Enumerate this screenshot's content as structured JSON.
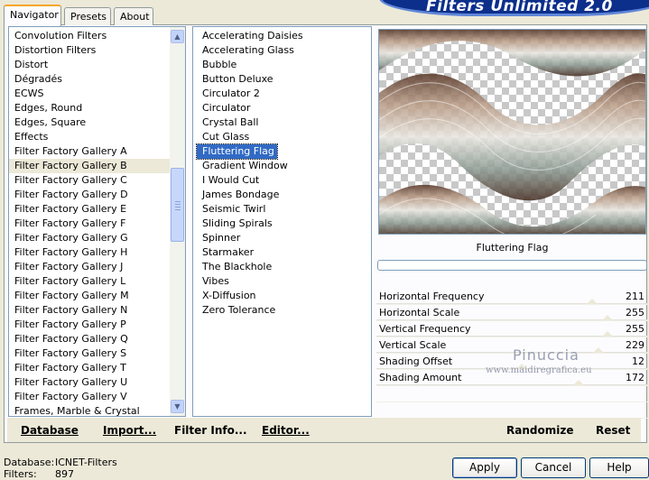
{
  "banner": {
    "title": "Filters Unlimited 2.0"
  },
  "tabs": [
    {
      "label": "Navigator",
      "active": true
    },
    {
      "label": "Presets",
      "active": false
    },
    {
      "label": "About",
      "active": false
    }
  ],
  "categories": {
    "selected_index": 10,
    "items": [
      "Convolution Filters",
      "Distortion Filters",
      "Distort",
      "Dégradés",
      "ECWS",
      "Edges, Round",
      "Edges, Square",
      "Effects",
      "Filter Factory Gallery A",
      "Filter Factory Gallery B",
      "Filter Factory Gallery C",
      "Filter Factory Gallery D",
      "Filter Factory Gallery E",
      "Filter Factory Gallery F",
      "Filter Factory Gallery G",
      "Filter Factory Gallery H",
      "Filter Factory Gallery J",
      "Filter Factory Gallery L",
      "Filter Factory Gallery M",
      "Filter Factory Gallery N",
      "Filter Factory Gallery P",
      "Filter Factory Gallery Q",
      "Filter Factory Gallery S",
      "Filter Factory Gallery T",
      "Filter Factory Gallery U",
      "Filter Factory Gallery V",
      "Frames, Marble & Crystal"
    ]
  },
  "filters": {
    "selected_index": 8,
    "items": [
      "Accelerating Daisies",
      "Accelerating Glass",
      "Bubble",
      "Button Deluxe",
      "Circulator 2",
      "Circulator",
      "Crystal Ball",
      "Cut Glass",
      "Fluttering Flag",
      "Gradient Window",
      "I Would Cut",
      "James Bondage",
      "Seismic Twirl",
      "Sliding Spirals",
      "Spinner",
      "Starmaker",
      "The Blackhole",
      "Vibes",
      "X-Diffusion",
      "Zero Tolerance"
    ]
  },
  "preview": {
    "label": "Fluttering Flag",
    "progress": 0
  },
  "parameters": [
    {
      "label": "Horizontal Frequency",
      "value": "211",
      "level": 0.827
    },
    {
      "label": "Horizontal Scale",
      "value": "255",
      "level": 1.0
    },
    {
      "label": "Vertical Frequency",
      "value": "255",
      "level": 1.0
    },
    {
      "label": "Vertical Scale",
      "value": "229",
      "level": 0.898
    },
    {
      "label": "Shading Offset",
      "value": "12",
      "level": 0.047
    },
    {
      "label": "Shading Amount",
      "value": "172",
      "level": 0.675
    }
  ],
  "watermark": {
    "name": "Pinuccia",
    "url": "www.maidiregrafica.eu"
  },
  "bottom_bar": {
    "database": "Database",
    "import": "Import...",
    "filter_info": "Filter Info...",
    "editor": "Editor...",
    "randomize": "Randomize",
    "reset": "Reset"
  },
  "status": {
    "database_label": "Database:",
    "database_value": "ICNET-Filters",
    "filters_label": "Filters:",
    "filters_value": "897"
  },
  "dialog": {
    "apply": "Apply",
    "cancel": "Cancel",
    "help": "Help"
  },
  "colors": {
    "selection": "#316ac5",
    "banner": "#0c2f8c",
    "window": "#ece9d8"
  }
}
